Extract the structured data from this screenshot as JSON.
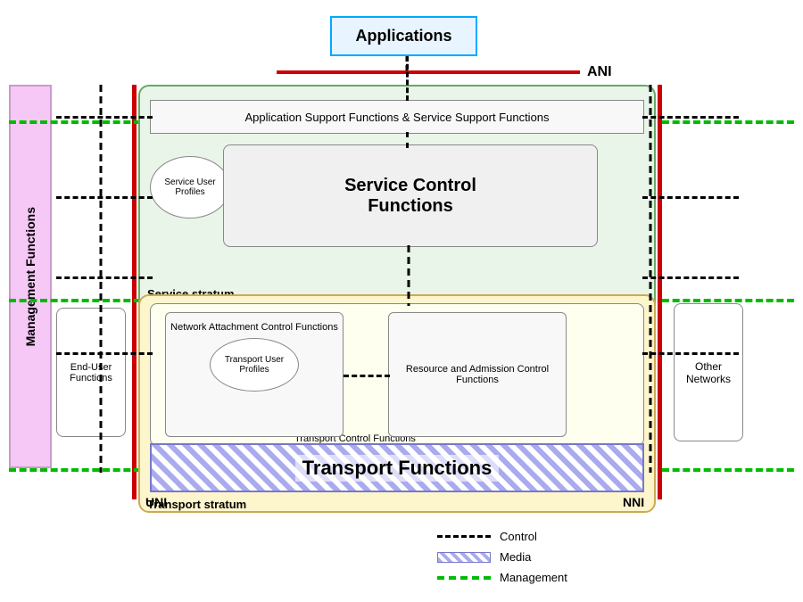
{
  "applications": {
    "label": "Applications"
  },
  "ani": {
    "label": "ANI"
  },
  "management_functions": {
    "label": "Management Functions"
  },
  "app_support": {
    "label": "Application Support Functions & Service Support Functions"
  },
  "service_control": {
    "label": "Service Control\nFunctions"
  },
  "service_user_profiles": {
    "label": "Service User Profiles"
  },
  "service_stratum": {
    "label": "Service stratum"
  },
  "nacf": {
    "title": "Network Attachment Control Functions"
  },
  "transport_user_profiles": {
    "label": "Transport User Profiles"
  },
  "racf": {
    "label": "Resource and Admission Control Functions"
  },
  "transport_control": {
    "label": "Transport Control Functions"
  },
  "transport_functions": {
    "label": "Transport  Functions"
  },
  "transport_stratum": {
    "label": "Transport stratum"
  },
  "end_user": {
    "label": "End-User Functions"
  },
  "other_networks": {
    "label": "Other Networks"
  },
  "uni": {
    "label": "UNI"
  },
  "nni": {
    "label": "NNI"
  },
  "legend": {
    "control_label": "Control",
    "media_label": "Media",
    "management_label": "Management"
  }
}
